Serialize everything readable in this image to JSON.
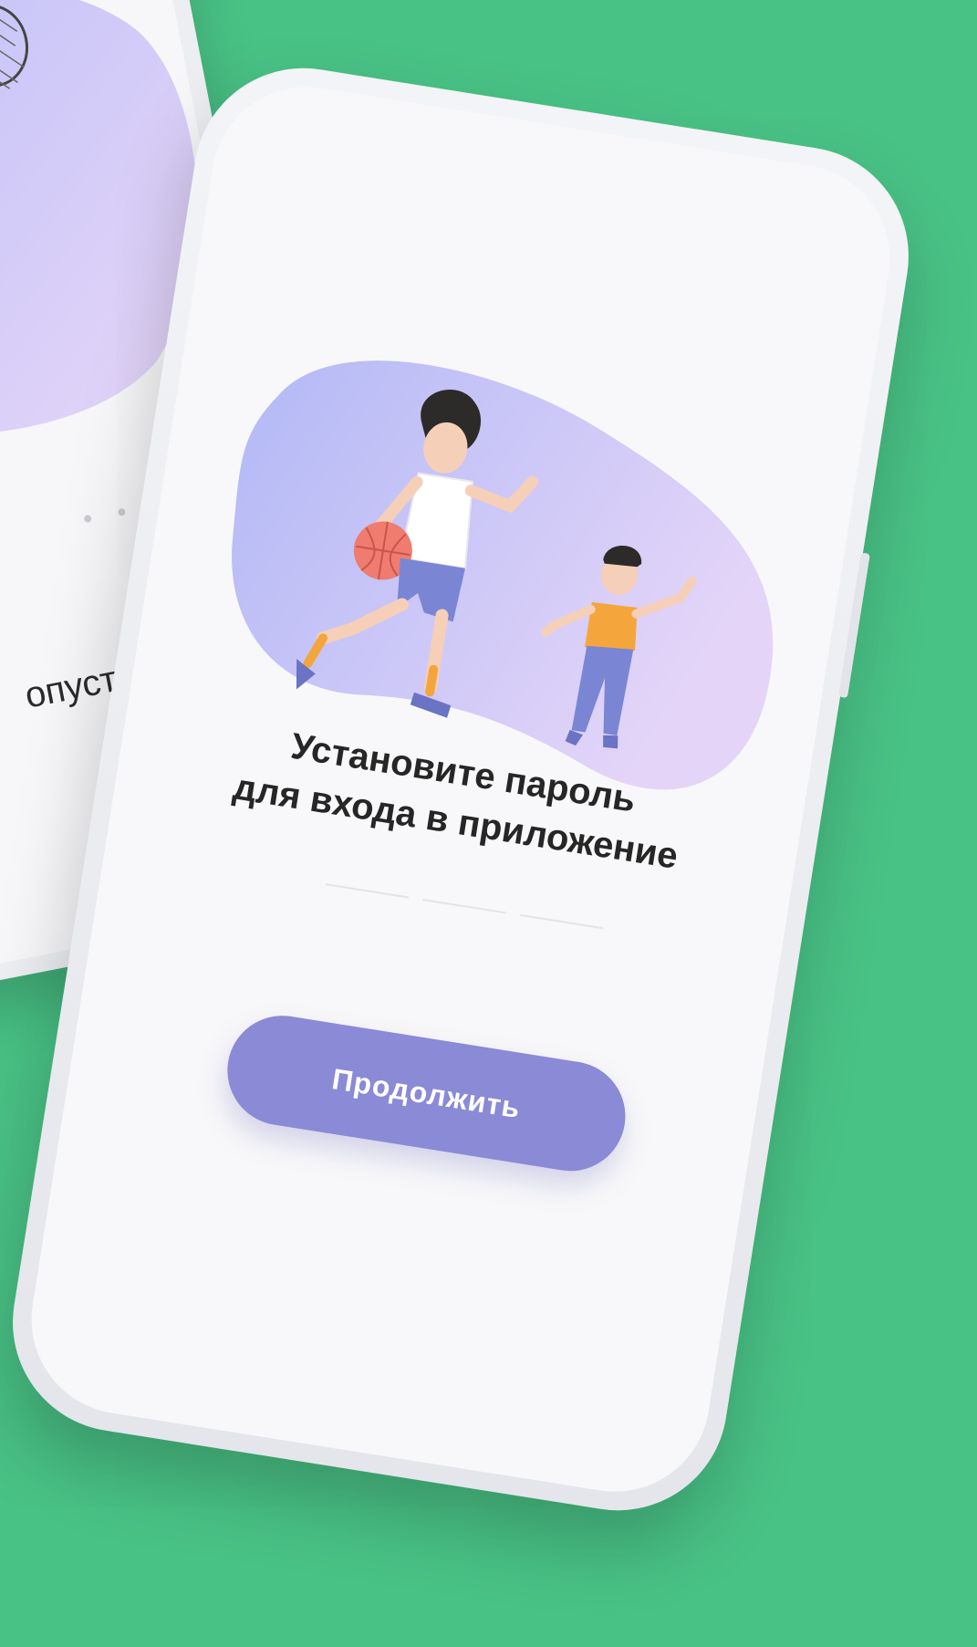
{
  "colors": {
    "background": "#49c286",
    "accent": "#8a8ad6",
    "blob_start": "#b7bcf7",
    "blob_end": "#e3d4f7"
  },
  "back_screen": {
    "skip_label": "опустить",
    "pagination_dots": 3
  },
  "front_screen": {
    "title_line1": "Установите пароль",
    "title_line2": "для входа в приложение",
    "pin_fields": 3,
    "continue_label": "Продолжить"
  },
  "icons": {
    "badminton": "girl-badminton-illustration",
    "basketball": "basketball-players-illustration"
  }
}
